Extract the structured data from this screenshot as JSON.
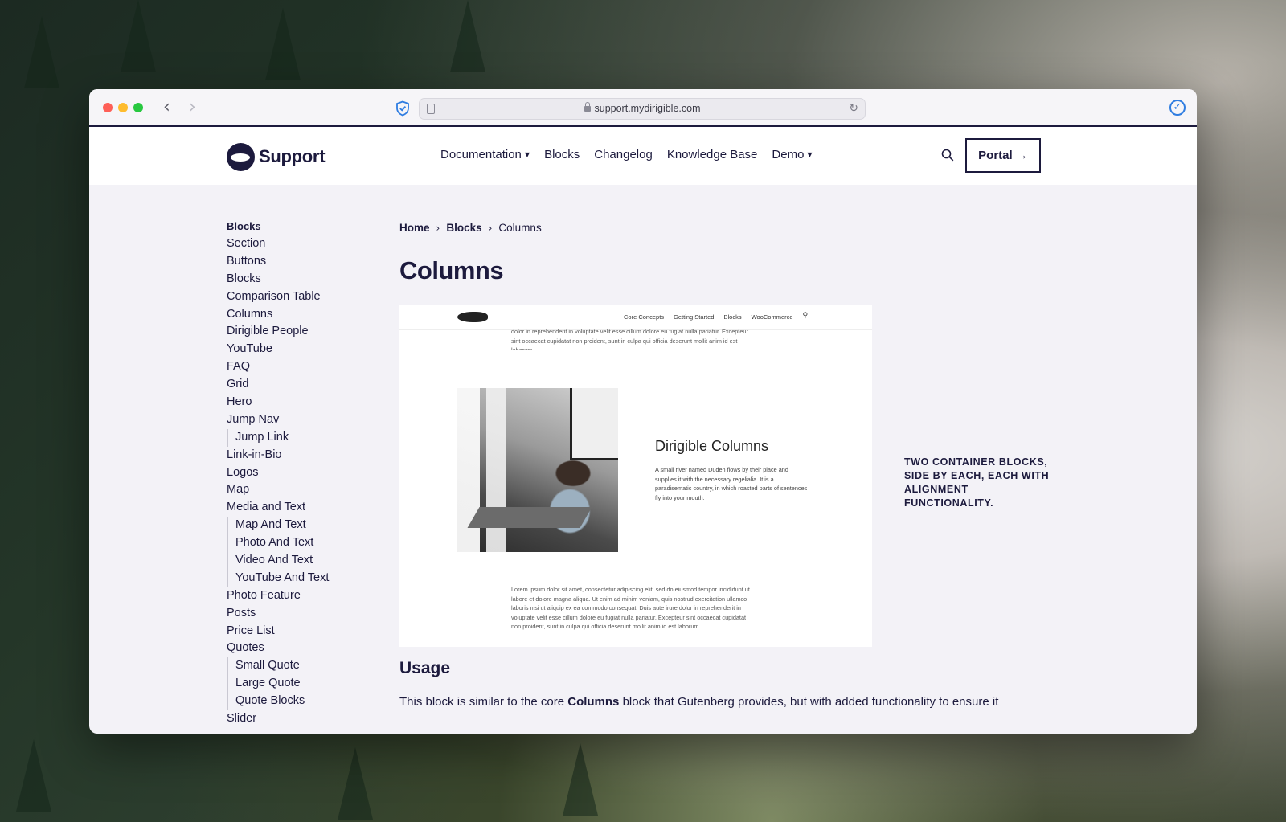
{
  "browser": {
    "url": "support.mydirigible.com"
  },
  "header": {
    "logo_text": "Support",
    "nav": [
      {
        "label": "Documentation",
        "dropdown": true
      },
      {
        "label": "Blocks",
        "dropdown": false
      },
      {
        "label": "Changelog",
        "dropdown": false
      },
      {
        "label": "Knowledge Base",
        "dropdown": false
      },
      {
        "label": "Demo",
        "dropdown": true
      }
    ],
    "portal_label": "Portal →"
  },
  "sidebar": {
    "heading": "Blocks",
    "items": [
      {
        "label": "Section",
        "sub": false
      },
      {
        "label": "Buttons",
        "sub": false
      },
      {
        "label": "Blocks",
        "sub": false
      },
      {
        "label": "Comparison Table",
        "sub": false
      },
      {
        "label": "Columns",
        "sub": false
      },
      {
        "label": "Dirigible People",
        "sub": false
      },
      {
        "label": "YouTube",
        "sub": false
      },
      {
        "label": "FAQ",
        "sub": false
      },
      {
        "label": "Grid",
        "sub": false
      },
      {
        "label": "Hero",
        "sub": false
      },
      {
        "label": "Jump Nav",
        "sub": false
      },
      {
        "label": "Jump Link",
        "sub": true
      },
      {
        "label": "Link-in-Bio",
        "sub": false
      },
      {
        "label": "Logos",
        "sub": false
      },
      {
        "label": "Map",
        "sub": false
      },
      {
        "label": "Media and Text",
        "sub": false
      },
      {
        "label": "Map And Text",
        "sub": true
      },
      {
        "label": "Photo And Text",
        "sub": true
      },
      {
        "label": "Video And Text",
        "sub": true
      },
      {
        "label": "YouTube And Text",
        "sub": true
      },
      {
        "label": "Photo Feature",
        "sub": false
      },
      {
        "label": "Posts",
        "sub": false
      },
      {
        "label": "Price List",
        "sub": false
      },
      {
        "label": "Quotes",
        "sub": false
      },
      {
        "label": "Small Quote",
        "sub": true
      },
      {
        "label": "Large Quote",
        "sub": true
      },
      {
        "label": "Quote Blocks",
        "sub": true
      },
      {
        "label": "Slider",
        "sub": false
      }
    ]
  },
  "breadcrumb": {
    "home": "Home",
    "section": "Blocks",
    "current": "Columns"
  },
  "page": {
    "title": "Columns",
    "caption": "TWO CONTAINER BLOCKS, SIDE BY EACH, EACH WITH ALIGNMENT FUNCTIONALITY.",
    "usage_title": "Usage",
    "usage_text_before": "This block is similar to the core ",
    "usage_text_bold": "Columns",
    "usage_text_after": " block that Gutenberg provides, but with added functionality to ensure it"
  },
  "preview": {
    "nav": [
      "Core Concepts",
      "Getting Started",
      "Blocks",
      "WooCommerce"
    ],
    "top_text": "dolor in reprehenderit in voluptate velit esse cillum dolore eu fugiat nulla pariatur. Excepteur sint occaecat cupidatat non proident, sunt in culpa qui officia deserunt mollit anim id est laborum.",
    "heading": "Dirigible Columns",
    "paragraph": "A small river named Duden flows by their place and supplies it with the necessary regelialia. It is a paradisematic country, in which roasted parts of sentences fly into your mouth.",
    "bottom_text": "Lorem ipsum dolor sit amet, consectetur adipiscing elit, sed do eiusmod tempor incididunt ut labore et dolore magna aliqua. Ut enim ad minim veniam, quis nostrud exercitation ullamco laboris nisi ut aliquip ex ea commodo consequat. Duis aute irure dolor in reprehenderit in voluptate velit esse cillum dolore eu fugiat nulla pariatur. Excepteur sint occaecat cupidatat non proident, sunt in culpa qui officia deserunt mollit anim id est laborum."
  },
  "colors": {
    "brand_navy": "#1c1a3d",
    "page_bg": "#f3f2f7",
    "browser_accent": "#2f7de1"
  }
}
